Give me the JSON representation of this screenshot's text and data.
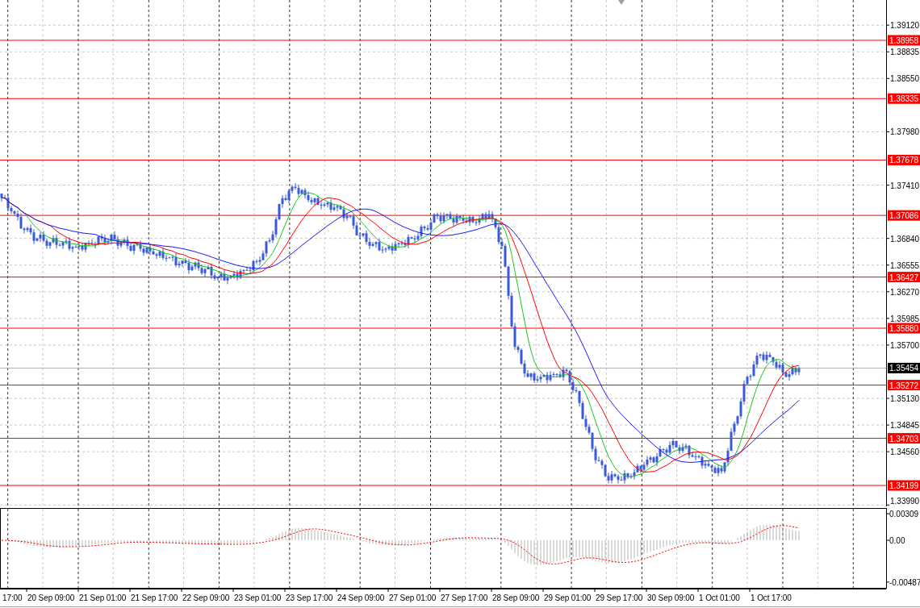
{
  "price_axis": {
    "labels": [
      "1.39120",
      "1.38835",
      "1.38550",
      "1.37980",
      "1.37410",
      "1.36840",
      "1.36555",
      "1.36270",
      "1.35985",
      "1.35700",
      "1.35130",
      "1.34845",
      "1.34560",
      "1.33990"
    ]
  },
  "price_levels": [
    {
      "kind": "level",
      "label": "1.38958",
      "color": "#ff0000"
    },
    {
      "kind": "level",
      "label": "1.38335",
      "color": "#ff0000"
    },
    {
      "kind": "level",
      "label": "1.37678",
      "color": "#ff0000"
    },
    {
      "kind": "level",
      "label": "1.37086",
      "color": "#ff0000"
    },
    {
      "kind": "level",
      "label": "1.36427",
      "color": "#ff0000"
    },
    {
      "kind": "level",
      "label": "1.35880",
      "color": "#ff0000"
    },
    {
      "kind": "bid",
      "label": "1.35454",
      "color": "#000000"
    },
    {
      "kind": "level",
      "label": "1.35272",
      "color": "#ff0000"
    },
    {
      "kind": "level",
      "label": "1.34703",
      "color": "#ff0000"
    },
    {
      "kind": "level",
      "label": "1.34199",
      "color": "#ff0000"
    }
  ],
  "time_axis": {
    "labels": [
      "17:00",
      "20 Sep 09:00",
      "21 Sep 01:00",
      "21 Sep 17:00",
      "22 Sep 09:00",
      "23 Sep 01:00",
      "23 Sep 17:00",
      "24 Sep 09:00",
      "27 Sep 01:00",
      "27 Sep 17:00",
      "28 Sep 09:00",
      "29 Sep 01:00",
      "29 Sep 17:00",
      "30 Sep 09:00",
      "1 Oct 01:00",
      "1 Oct 17:00"
    ]
  },
  "indicator_axis": {
    "labels": [
      "0.00309",
      "0.00",
      "-0.00487"
    ]
  }
}
